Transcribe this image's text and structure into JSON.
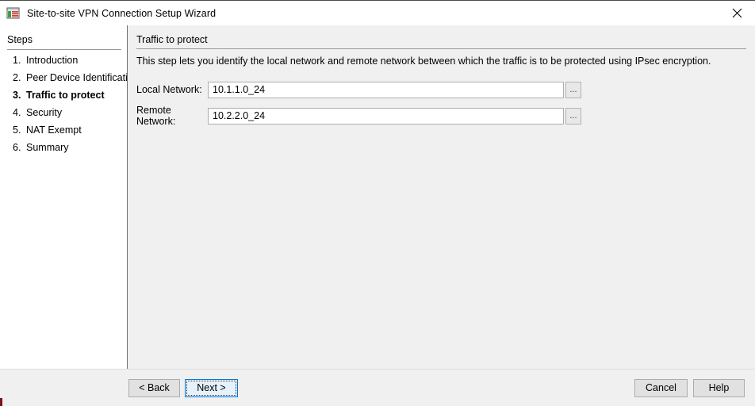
{
  "window": {
    "title": "Site-to-site VPN Connection Setup Wizard",
    "icon": "vpn-wizard-icon",
    "close_label": "✕",
    "accent_color": "#0078d7",
    "sidebar_bg": "#ffffff",
    "main_bg": "#f0f0f0"
  },
  "sidebar": {
    "heading": "Steps",
    "items": [
      {
        "num": "1.",
        "label": "Introduction",
        "active": false
      },
      {
        "num": "2.",
        "label": "Peer Device Identificatio",
        "active": false
      },
      {
        "num": "3.",
        "label": "Traffic to protect",
        "active": true
      },
      {
        "num": "4.",
        "label": "Security",
        "active": false
      },
      {
        "num": "5.",
        "label": "NAT Exempt",
        "active": false
      },
      {
        "num": "6.",
        "label": "Summary",
        "active": false
      }
    ]
  },
  "main": {
    "title": "Traffic to protect",
    "description": "This step lets you identify the local network and remote network between which the traffic is to be protected using IPsec encryption.",
    "fields": [
      {
        "label": "Local Network:",
        "value": "10.1.1.0_24",
        "placeholder": "",
        "browse_label": "..."
      },
      {
        "label": "Remote Network:",
        "value": "10.2.2.0_24",
        "placeholder": "",
        "browse_label": "..."
      }
    ]
  },
  "footer": {
    "back_label": "< Back",
    "next_label": "Next >",
    "cancel_label": "Cancel",
    "help_label": "Help"
  }
}
